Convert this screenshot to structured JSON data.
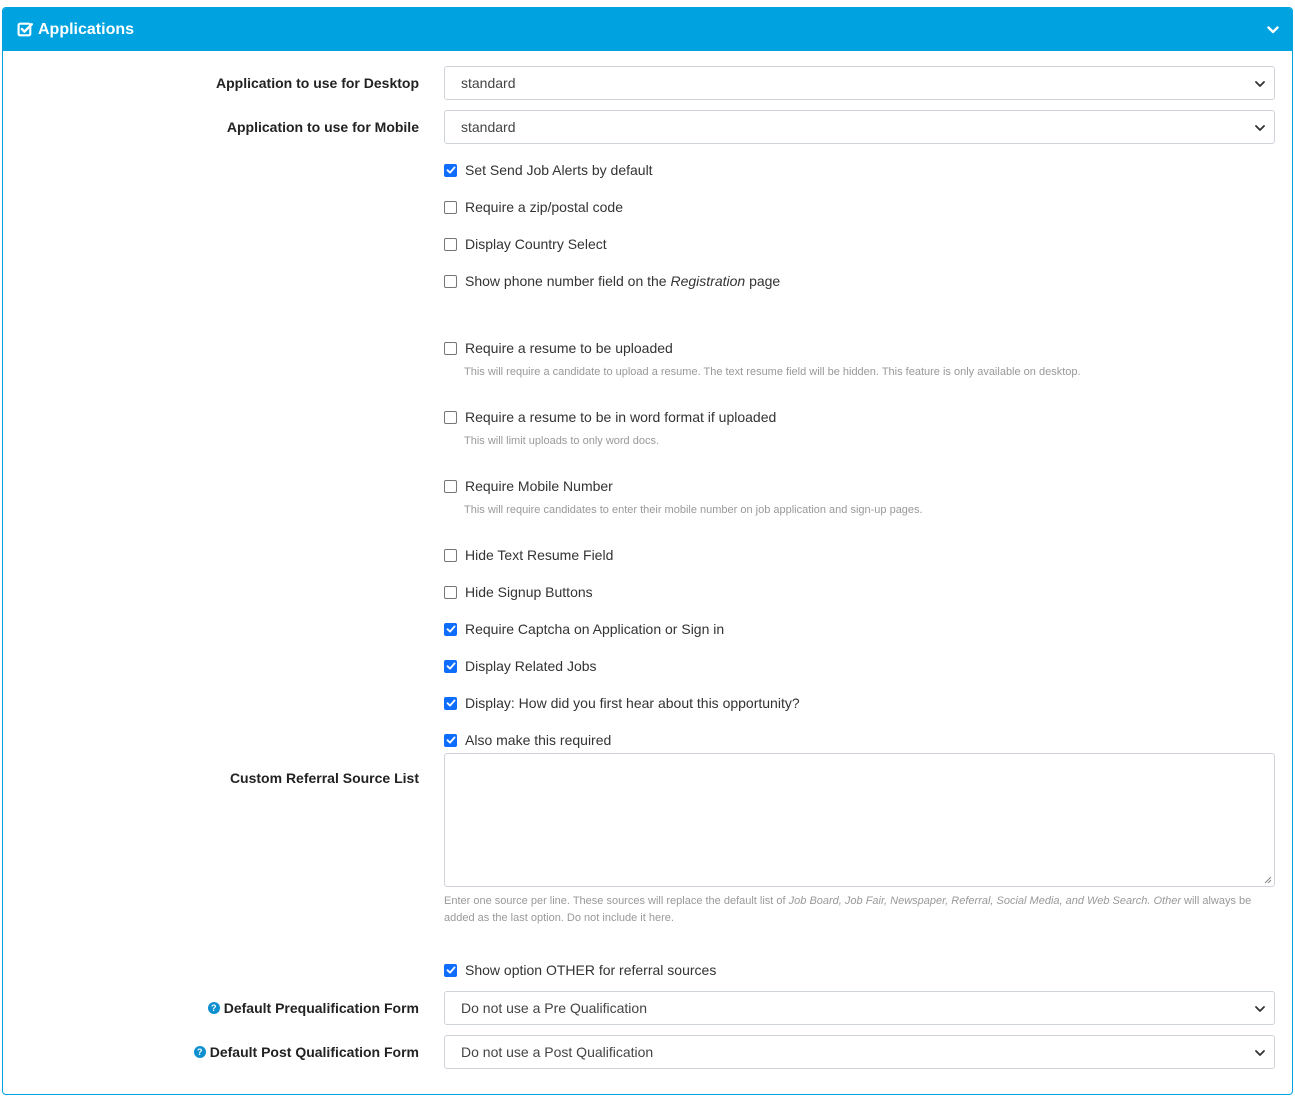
{
  "panel": {
    "title": "Applications"
  },
  "desktop": {
    "label": "Application to use for Desktop",
    "value": "standard"
  },
  "mobile": {
    "label": "Application to use for Mobile",
    "value": "standard"
  },
  "options": {
    "send_job_alerts": {
      "label": "Set Send Job Alerts by default",
      "checked": true
    },
    "require_zip": {
      "label": "Require a zip/postal code",
      "checked": false
    },
    "display_country": {
      "label": "Display Country Select",
      "checked": false
    },
    "show_phone": {
      "label_a": "Show phone number field on the ",
      "label_em": "Registration",
      "label_b": " page",
      "checked": false
    },
    "require_resume": {
      "label": "Require a resume to be uploaded",
      "help": "This will require a candidate to upload a resume. The text resume field will be hidden. This feature is only available on desktop.",
      "checked": false
    },
    "require_word": {
      "label": "Require a resume to be in word format if uploaded",
      "help": "This will limit uploads to only word docs.",
      "checked": false
    },
    "require_mobile": {
      "label": "Require Mobile Number",
      "help": "This will require candidates to enter their mobile number on job application and sign-up pages.",
      "checked": false
    },
    "hide_text_resume": {
      "label": "Hide Text Resume Field",
      "checked": false
    },
    "hide_signup": {
      "label": "Hide Signup Buttons",
      "checked": false
    },
    "require_captcha": {
      "label": "Require Captcha on Application or Sign in",
      "checked": true
    },
    "display_related": {
      "label": "Display Related Jobs",
      "checked": true
    },
    "display_hear": {
      "label": "Display: How did you first hear about this opportunity?",
      "checked": true
    },
    "also_required": {
      "label": "Also make this required",
      "checked": true
    },
    "show_other": {
      "label": "Show option OTHER for referral sources",
      "checked": true
    }
  },
  "referral": {
    "label": "Custom Referral Source List",
    "value": "",
    "help_a": "Enter one source per line. These sources will replace the default list of ",
    "help_em": "Job Board, Job Fair, Newspaper, Referral, Social Media, and Web Search. Other",
    "help_b": " will always be added as the last option. Do not include it here."
  },
  "prequal": {
    "label": "Default Prequalification Form",
    "value": "Do not use a Pre Qualification"
  },
  "postqual": {
    "label": "Default Post Qualification Form",
    "value": "Do not use a Post Qualification"
  },
  "colors": {
    "accent": "#00a3e0",
    "checkbox": "#0d6efd"
  }
}
